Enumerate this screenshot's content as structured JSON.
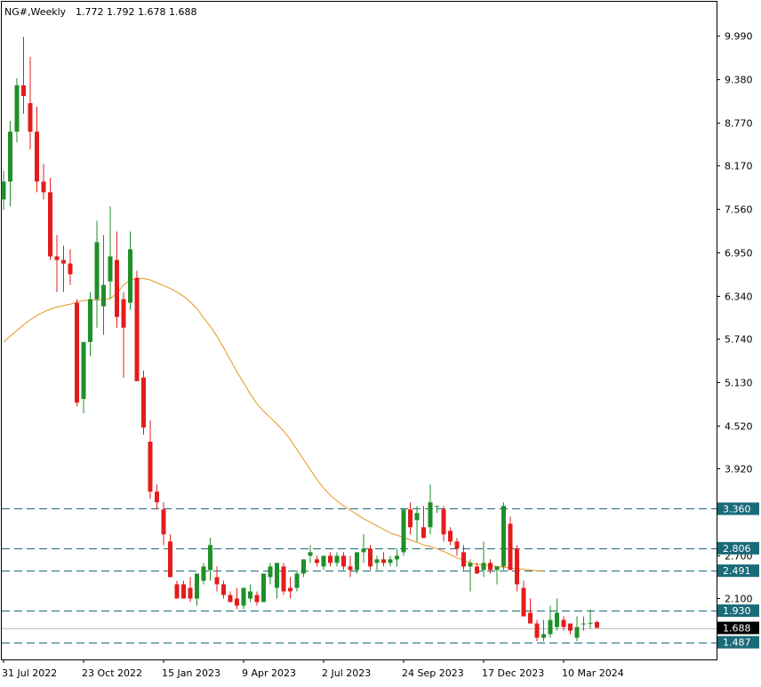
{
  "header": {
    "symbol": "NG#,Weekly",
    "ohlc": "1.772 1.792 1.678 1.688"
  },
  "colors": {
    "bull": "#1f8f2a",
    "bear": "#e41c1c",
    "ma": "#e8951c",
    "level_line": "#1a6b7a",
    "level_box": "#1a6b7a",
    "current_box": "#000000",
    "frame": "#000000"
  },
  "chart_data": {
    "type": "candlestick",
    "title": "NG#,Weekly",
    "ylim": [
      1.3,
      10.42
    ],
    "grid": false,
    "y_ticks": [
      "9.990",
      "9.380",
      "8.770",
      "8.170",
      "7.560",
      "6.950",
      "6.340",
      "5.740",
      "5.130",
      "4.520",
      "3.920",
      "2.700",
      "2.100"
    ],
    "x_ticks": [
      "31 Jul 2022",
      "23 Oct 2022",
      "15 Jan 2023",
      "9 Apr 2023",
      "2 Jul 2023",
      "24 Sep 2023",
      "17 Dec 2023",
      "10 Mar 2024"
    ],
    "x_tick_index": [
      0,
      12,
      24,
      36,
      48,
      60,
      72,
      84
    ],
    "levels": [
      "3.360",
      "2.806",
      "2.491",
      "1.930",
      "1.487"
    ],
    "current_price": "1.688",
    "candles": [
      [
        7.7,
        8.1,
        7.55,
        7.95
      ],
      [
        7.95,
        8.8,
        7.6,
        8.65
      ],
      [
        8.65,
        9.4,
        8.5,
        9.3
      ],
      [
        9.3,
        9.98,
        8.9,
        9.15
      ],
      [
        9.05,
        9.7,
        8.4,
        8.65
      ],
      [
        8.65,
        9.0,
        7.8,
        7.95
      ],
      [
        7.95,
        8.2,
        7.7,
        7.8
      ],
      [
        7.8,
        8.0,
        6.85,
        6.9
      ],
      [
        6.9,
        7.2,
        6.4,
        6.85
      ],
      [
        6.85,
        7.05,
        6.4,
        6.8
      ],
      [
        6.8,
        7.0,
        6.5,
        6.65
      ],
      [
        6.25,
        6.3,
        4.8,
        4.85
      ],
      [
        4.9,
        5.7,
        4.7,
        5.7
      ],
      [
        5.7,
        6.4,
        5.5,
        6.3
      ],
      [
        6.3,
        7.4,
        5.9,
        7.1
      ],
      [
        6.2,
        7.2,
        5.8,
        6.5
      ],
      [
        6.55,
        7.6,
        6.3,
        6.9
      ],
      [
        6.85,
        7.25,
        5.9,
        6.05
      ],
      [
        6.3,
        6.4,
        5.2,
        5.9
      ],
      [
        6.25,
        7.25,
        6.15,
        7.0
      ],
      [
        6.6,
        6.7,
        5.2,
        5.15
      ],
      [
        5.2,
        5.3,
        4.4,
        4.5
      ],
      [
        4.3,
        4.6,
        3.5,
        3.6
      ],
      [
        3.6,
        3.7,
        3.35,
        3.45
      ],
      [
        3.35,
        3.45,
        2.85,
        3.0
      ],
      [
        2.9,
        3.0,
        2.4,
        2.4
      ],
      [
        2.3,
        2.35,
        2.1,
        2.1
      ],
      [
        2.3,
        2.35,
        2.2,
        2.1
      ],
      [
        2.25,
        2.4,
        2.05,
        2.1
      ],
      [
        2.1,
        2.4,
        2.0,
        2.45
      ],
      [
        2.35,
        2.6,
        2.3,
        2.55
      ],
      [
        2.5,
        2.95,
        2.35,
        2.85
      ],
      [
        2.4,
        2.55,
        2.2,
        2.3
      ],
      [
        2.3,
        2.35,
        2.1,
        2.15
      ],
      [
        2.15,
        2.2,
        2.05,
        2.05
      ],
      [
        2.1,
        2.25,
        1.95,
        2.0
      ],
      [
        2.0,
        2.25,
        1.95,
        2.25
      ],
      [
        2.1,
        2.3,
        2.05,
        2.2
      ],
      [
        2.15,
        2.2,
        2.0,
        2.05
      ],
      [
        2.05,
        2.45,
        2.05,
        2.45
      ],
      [
        2.4,
        2.6,
        2.3,
        2.55
      ],
      [
        2.25,
        2.6,
        2.1,
        2.6
      ],
      [
        2.55,
        2.6,
        2.15,
        2.2
      ],
      [
        2.25,
        2.4,
        2.1,
        2.2
      ],
      [
        2.25,
        2.5,
        2.2,
        2.45
      ],
      [
        2.45,
        2.65,
        2.4,
        2.65
      ],
      [
        2.7,
        2.85,
        2.6,
        2.75
      ],
      [
        2.65,
        2.7,
        2.55,
        2.6
      ],
      [
        2.55,
        2.7,
        2.5,
        2.7
      ],
      [
        2.7,
        2.75,
        2.55,
        2.6
      ],
      [
        2.6,
        2.75,
        2.55,
        2.7
      ],
      [
        2.7,
        2.75,
        2.5,
        2.55
      ],
      [
        2.55,
        2.7,
        2.4,
        2.5
      ],
      [
        2.5,
        2.75,
        2.45,
        2.75
      ],
      [
        2.75,
        3.0,
        2.6,
        2.8
      ],
      [
        2.8,
        2.85,
        2.5,
        2.55
      ],
      [
        2.6,
        2.7,
        2.5,
        2.65
      ],
      [
        2.65,
        2.75,
        2.55,
        2.6
      ],
      [
        2.6,
        2.7,
        2.55,
        2.65
      ],
      [
        2.65,
        2.8,
        2.55,
        2.7
      ],
      [
        2.75,
        3.25,
        2.7,
        3.35
      ],
      [
        3.35,
        3.45,
        3.0,
        3.1
      ],
      [
        3.2,
        3.4,
        2.9,
        3.3
      ],
      [
        3.1,
        3.4,
        2.95,
        2.95
      ],
      [
        3.1,
        3.7,
        3.0,
        3.45
      ],
      [
        3.4,
        3.4,
        3.3,
        3.4
      ],
      [
        3.35,
        3.4,
        2.9,
        3.0
      ],
      [
        3.05,
        3.1,
        2.85,
        2.9
      ],
      [
        2.9,
        2.95,
        2.7,
        2.8
      ],
      [
        2.75,
        2.85,
        2.5,
        2.55
      ],
      [
        2.55,
        2.65,
        2.2,
        2.6
      ],
      [
        2.55,
        2.6,
        2.45,
        2.45
      ],
      [
        2.5,
        2.9,
        2.4,
        2.6
      ],
      [
        2.6,
        2.65,
        2.45,
        2.5
      ],
      [
        2.5,
        2.55,
        2.3,
        2.55
      ],
      [
        2.55,
        3.45,
        2.5,
        3.4
      ],
      [
        3.15,
        3.25,
        2.5,
        2.5
      ],
      [
        2.8,
        2.85,
        2.2,
        2.3
      ],
      [
        2.25,
        2.35,
        1.9,
        1.85
      ],
      [
        1.9,
        2.1,
        1.8,
        1.75
      ],
      [
        1.75,
        1.8,
        1.5,
        1.55
      ],
      [
        1.55,
        1.8,
        1.5,
        1.6
      ],
      [
        1.6,
        2.0,
        1.55,
        1.8
      ],
      [
        1.7,
        2.1,
        1.65,
        1.9
      ],
      [
        1.8,
        1.85,
        1.65,
        1.7
      ],
      [
        1.75,
        1.75,
        1.6,
        1.65
      ],
      [
        1.55,
        1.85,
        1.5,
        1.7
      ],
      [
        1.75,
        1.85,
        1.65,
        1.75
      ],
      [
        1.75,
        1.95,
        1.68,
        1.76
      ],
      [
        1.77,
        1.79,
        1.68,
        1.69
      ]
    ],
    "ma": [
      5.7,
      5.78,
      5.86,
      5.94,
      6.01,
      6.07,
      6.12,
      6.16,
      6.19,
      6.21,
      6.23,
      6.26,
      6.28,
      6.29,
      6.29,
      6.29,
      6.31,
      6.38,
      6.5,
      6.57,
      6.59,
      6.59,
      6.57,
      6.53,
      6.49,
      6.45,
      6.4,
      6.34,
      6.26,
      6.17,
      6.04,
      5.92,
      5.78,
      5.62,
      5.45,
      5.28,
      5.13,
      4.97,
      4.83,
      4.73,
      4.64,
      4.55,
      4.45,
      4.33,
      4.19,
      4.05,
      3.91,
      3.77,
      3.65,
      3.55,
      3.47,
      3.4,
      3.34,
      3.28,
      3.22,
      3.17,
      3.12,
      3.07,
      3.02,
      2.99,
      2.96,
      2.92,
      2.89,
      2.85,
      2.83,
      2.8,
      2.76,
      2.72,
      2.67,
      2.64,
      2.6,
      2.58,
      2.57,
      2.56,
      2.55,
      2.54,
      2.53,
      2.52,
      2.51,
      2.5,
      2.49,
      2.49
    ]
  }
}
